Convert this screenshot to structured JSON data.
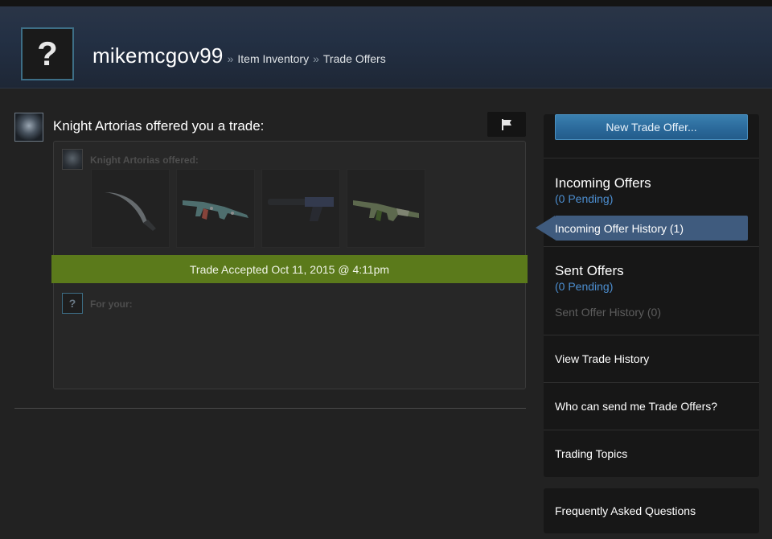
{
  "header": {
    "avatar_glyph": "?",
    "username": "mikemcgov99",
    "separator": "»",
    "breadcrumbs": [
      "Item Inventory",
      "Trade Offers"
    ]
  },
  "offer": {
    "title": "Knight Artorias offered you a trade:",
    "offerer_label": "Knight Artorias offered:",
    "items": [
      {
        "icon": "curved-knife-icon"
      },
      {
        "icon": "ak47-rifle-icon"
      },
      {
        "icon": "silenced-pistol-icon"
      },
      {
        "icon": "green-rifle-icon"
      }
    ],
    "status": "Trade Accepted Oct 11, 2015 @ 4:11pm",
    "your_glyph": "?",
    "your_label": "For your:",
    "flag_icon": "flag-icon"
  },
  "sidebar": {
    "new_offer": "New Trade Offer...",
    "incoming": {
      "title": "Incoming Offers",
      "pending": "(0 Pending)",
      "history": "Incoming Offer History (1)"
    },
    "sent": {
      "title": "Sent Offers",
      "pending": "(0 Pending)",
      "history": "Sent Offer History (0)"
    },
    "links": [
      "View Trade History",
      "Who can send me Trade Offers?",
      "Trading Topics"
    ],
    "faq": "Frequently Asked Questions"
  },
  "colors": {
    "accepted_banner": "#5b7a1b",
    "pending_link": "#4c8ed0",
    "active_tab": "#3f5b7e",
    "primary_button": "#2a6899"
  }
}
